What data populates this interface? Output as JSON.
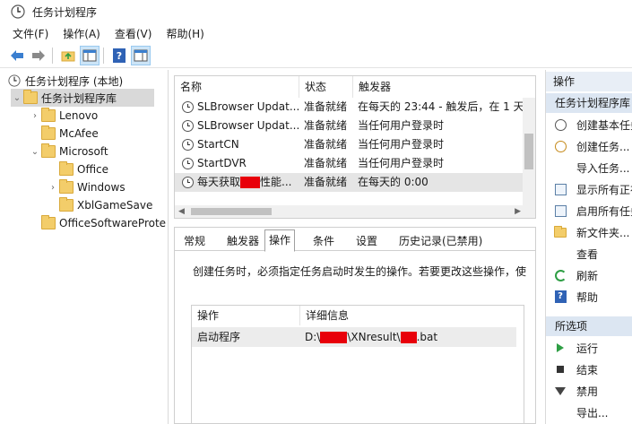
{
  "window": {
    "title": "任务计划程序"
  },
  "menu": [
    "文件(F)",
    "操作(A)",
    "查看(V)",
    "帮助(H)"
  ],
  "tree": {
    "items": [
      {
        "label": "任务计划程序 (本地)",
        "level": 0,
        "expander": "",
        "icon": "clock-icon"
      },
      {
        "label": "任务计划程序库",
        "level": 1,
        "expander": "⌄",
        "icon": "folder-icon",
        "selected": true
      },
      {
        "label": "Lenovo",
        "level": 2,
        "expander": "›",
        "icon": "folder-icon"
      },
      {
        "label": "McAfee",
        "level": 2,
        "expander": "",
        "icon": "folder-icon"
      },
      {
        "label": "Microsoft",
        "level": 2,
        "expander": "⌄",
        "icon": "folder-icon"
      },
      {
        "label": "Office",
        "level": 3,
        "expander": "",
        "icon": "folder-icon"
      },
      {
        "label": "Windows",
        "level": 3,
        "expander": "›",
        "icon": "folder-icon"
      },
      {
        "label": "XblGameSave",
        "level": 3,
        "expander": "",
        "icon": "folder-icon"
      },
      {
        "label": "OfficeSoftwareProte",
        "level": 2,
        "expander": "",
        "icon": "folder-icon"
      }
    ]
  },
  "tasks": {
    "columns": [
      "名称",
      "状态",
      "触发器"
    ],
    "rows": [
      {
        "name": "SLBrowser Updat...",
        "status": "准备就绪",
        "trigger": "在每天的 23:44 - 触发后，在 1 天"
      },
      {
        "name": "SLBrowser Updat...",
        "status": "准备就绪",
        "trigger": "当任何用户登录时"
      },
      {
        "name": "StartCN",
        "status": "准备就绪",
        "trigger": "当任何用户登录时"
      },
      {
        "name": "StartDVR",
        "status": "准备就绪",
        "trigger": "当任何用户登录时"
      },
      {
        "name_prefix": "每天获取",
        "name_suffix": "性能...",
        "status": "准备就绪",
        "trigger": "在每天的 0:00",
        "selected": true
      }
    ]
  },
  "detail": {
    "tabs": [
      "常规",
      "触发器",
      "操作",
      "条件",
      "设置",
      "历史记录(已禁用)"
    ],
    "active_tab": "操作",
    "description": "创建任务时，必须指定任务启动时发生的操作。若要更改这些操作，使",
    "action_columns": [
      "操作",
      "详细信息"
    ],
    "action_rows": [
      {
        "action": "启动程序",
        "detail_prefix": "D:\\",
        "detail_middle": "\\XNresult\\",
        "detail_suffix": ".bat"
      }
    ]
  },
  "actions_pane": {
    "header": "操作",
    "section1": "任务计划程序库",
    "items1": [
      {
        "label": "创建基本任务",
        "icon": "clock-icon"
      },
      {
        "label": "创建任务...",
        "icon": "task-icon"
      },
      {
        "label": "导入任务...",
        "icon": ""
      },
      {
        "label": "显示所有正在",
        "icon": "list-icon"
      },
      {
        "label": "启用所有任务",
        "icon": "history-icon"
      },
      {
        "label": "新文件夹...",
        "icon": "folder-icon"
      },
      {
        "label": "查看",
        "icon": ""
      },
      {
        "label": "刷新",
        "icon": "refresh-icon"
      },
      {
        "label": "帮助",
        "icon": "help-icon"
      }
    ],
    "section2": "所选项",
    "items2": [
      {
        "label": "运行",
        "icon": "play-icon"
      },
      {
        "label": "结束",
        "icon": "stop-icon"
      },
      {
        "label": "禁用",
        "icon": "disable-icon"
      },
      {
        "label": "导出...",
        "icon": ""
      }
    ]
  },
  "colors": {
    "redaction": "#e8000a",
    "selection": "#d9d9d9",
    "section_header": "#dce6f2"
  }
}
